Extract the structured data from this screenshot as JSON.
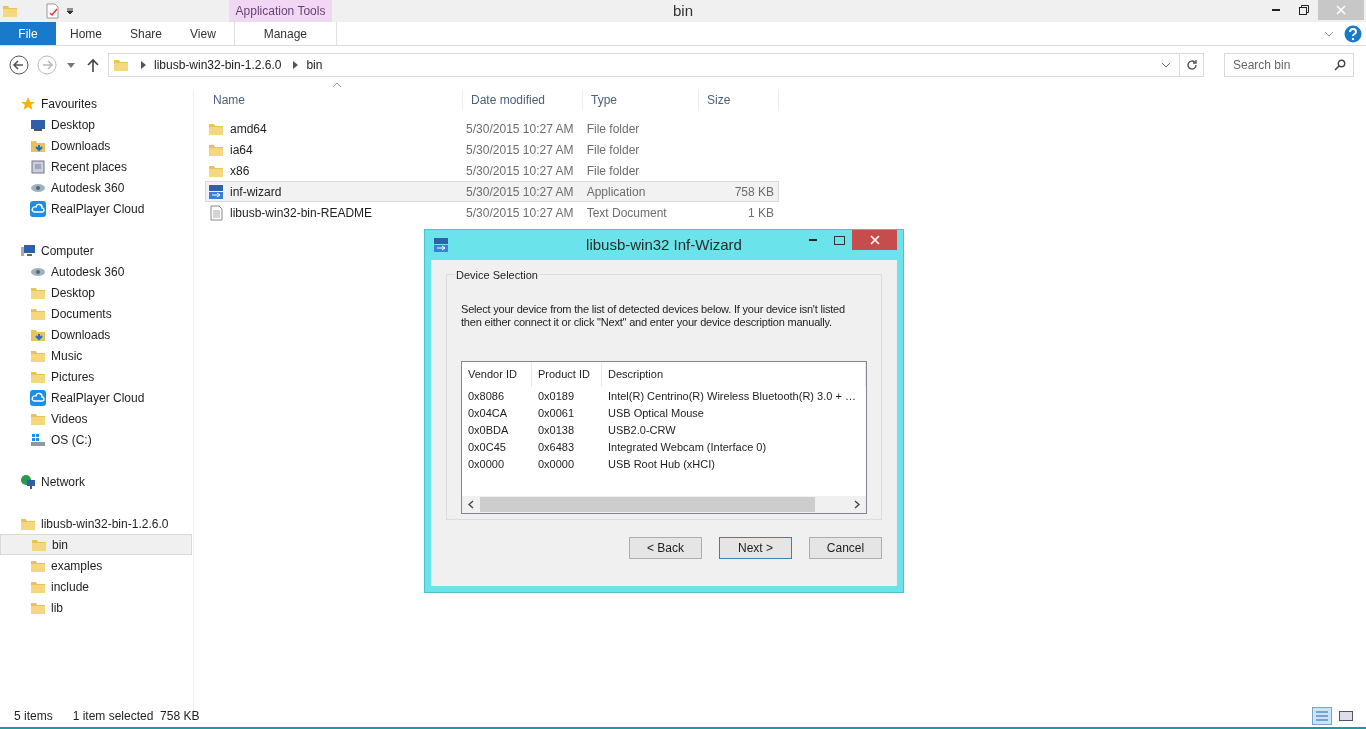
{
  "window": {
    "title": "bin",
    "context_tab_group": "Application Tools"
  },
  "ribbon_tabs": [
    {
      "label": "File",
      "kind": "file"
    },
    {
      "label": "Home",
      "kind": "tab"
    },
    {
      "label": "Share",
      "kind": "tab"
    },
    {
      "label": "View",
      "kind": "tab"
    },
    {
      "label": "Manage",
      "kind": "context"
    }
  ],
  "address_bar": {
    "path": [
      "libusb-win32-bin-1.2.6.0",
      "bin"
    ]
  },
  "search": {
    "placeholder": "Search bin"
  },
  "sidebar": [
    {
      "label": "Favourites",
      "kind": "star",
      "children": [
        {
          "label": "Desktop",
          "kind": "monitor",
          "selected": false
        },
        {
          "label": "Downloads",
          "kind": "download",
          "selected": false
        },
        {
          "label": "Recent places",
          "kind": "recent",
          "selected": false
        },
        {
          "label": "Autodesk 360",
          "kind": "eye",
          "selected": false
        },
        {
          "label": "RealPlayer Cloud",
          "kind": "cloud",
          "selected": false
        }
      ]
    },
    {
      "label": "Computer",
      "kind": "computer",
      "children": [
        {
          "label": "Autodesk 360",
          "kind": "eye",
          "selected": false
        },
        {
          "label": "Desktop",
          "kind": "folder",
          "selected": false
        },
        {
          "label": "Documents",
          "kind": "folder",
          "selected": false
        },
        {
          "label": "Downloads",
          "kind": "download",
          "selected": false
        },
        {
          "label": "Music",
          "kind": "folder",
          "selected": false
        },
        {
          "label": "Pictures",
          "kind": "folder",
          "selected": false
        },
        {
          "label": "RealPlayer Cloud",
          "kind": "cloud",
          "selected": false
        },
        {
          "label": "Videos",
          "kind": "folder",
          "selected": false
        },
        {
          "label": "OS (C:)",
          "kind": "drive",
          "selected": false
        }
      ]
    },
    {
      "label": "Network",
      "kind": "network"
    },
    {
      "label": "libusb-win32-bin-1.2.6.0",
      "kind": "folder",
      "children": [
        {
          "label": "bin",
          "kind": "folder",
          "selected": true
        },
        {
          "label": "examples",
          "kind": "folder",
          "selected": false
        },
        {
          "label": "include",
          "kind": "folder",
          "selected": false
        },
        {
          "label": "lib",
          "kind": "folder",
          "selected": false
        }
      ]
    }
  ],
  "file_list": {
    "columns": [
      "Name",
      "Date modified",
      "Type",
      "Size"
    ],
    "rows": [
      {
        "name": "amd64",
        "kind": "folder",
        "date": "5/30/2015 10:27 AM",
        "type": "File folder",
        "size": "",
        "selected": false
      },
      {
        "name": "ia64",
        "kind": "folder",
        "date": "5/30/2015 10:27 AM",
        "type": "File folder",
        "size": "",
        "selected": false
      },
      {
        "name": "x86",
        "kind": "folder",
        "date": "5/30/2015 10:27 AM",
        "type": "File folder",
        "size": "",
        "selected": false
      },
      {
        "name": "inf-wizard",
        "kind": "app",
        "date": "5/30/2015 10:27 AM",
        "type": "Application",
        "size": "758 KB",
        "selected": true
      },
      {
        "name": "libusb-win32-bin-README",
        "kind": "text",
        "date": "5/30/2015 10:27 AM",
        "type": "Text Document",
        "size": "1 KB",
        "selected": false
      }
    ]
  },
  "status_bar": {
    "count": "5 items",
    "selection": "1 item selected  758 KB"
  },
  "dialog": {
    "title": "libusb-win32 Inf-Wizard",
    "group": "Device Selection",
    "instructions": "Select your device from the list of detected devices below. If your device isn't listed then either connect it or click \"Next\" and enter your device description manually.",
    "columns": [
      "Vendor ID",
      "Product ID",
      "Description"
    ],
    "rows": [
      [
        "0x8086",
        "0x0189",
        "Intel(R) Centrino(R) Wireless Bluetooth(R) 3.0 + …"
      ],
      [
        "0x04CA",
        "0x0061",
        "USB Optical Mouse"
      ],
      [
        "0x0BDA",
        "0x0138",
        "USB2.0-CRW"
      ],
      [
        "0x0C45",
        "0x6483",
        "Integrated Webcam (Interface 0)"
      ],
      [
        "0x0000",
        "0x0000",
        "USB Root Hub (xHCI)"
      ]
    ],
    "buttons": [
      {
        "label": "< Back",
        "focused": false
      },
      {
        "label": "Next >",
        "focused": true
      },
      {
        "label": "Cancel",
        "focused": false
      }
    ]
  }
}
